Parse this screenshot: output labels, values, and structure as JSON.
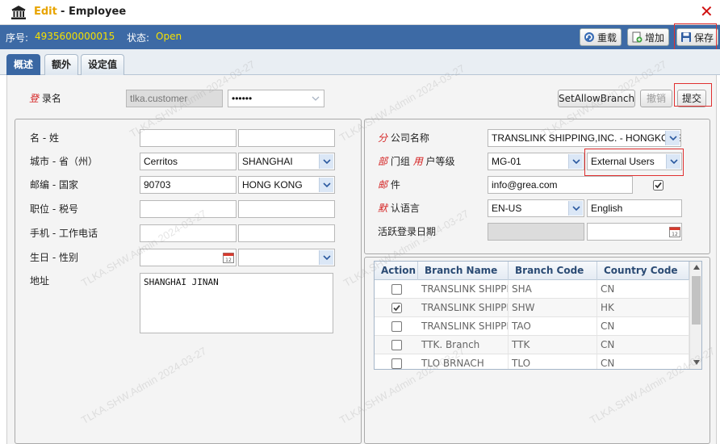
{
  "window": {
    "title_action": "Edit",
    "title_separator": "-",
    "title_entity": "Employee"
  },
  "infobar": {
    "serial_label": "序号:",
    "serial_value": "4935600000015",
    "status_label": "状态:",
    "status_value": "Open",
    "reload_label": "重载",
    "add_label": "增加",
    "save_label": "保存"
  },
  "tabs": [
    {
      "label": "概述"
    },
    {
      "label": "额外"
    },
    {
      "label": "设定值"
    }
  ],
  "login": {
    "label_req": "登",
    "label_rest": "录名",
    "username": "tlka.customer",
    "password": "••••••",
    "set_allow_branch_label": "SetAllowBranch",
    "cancel_label": "撤销",
    "submit_label": "提交"
  },
  "left_form": {
    "name_label": "名 - 姓",
    "first_name": "",
    "last_name": "",
    "city_label": "城市 - 省（州）",
    "city": "Cerritos",
    "province": "SHANGHAI",
    "postal_label": "邮编 - 国家",
    "postal": "90703",
    "country": "HONG KONG",
    "position_label": "职位 - 税号",
    "position": "",
    "tax_no": "",
    "mobile_label": "手机 - 工作电话",
    "mobile": "",
    "work_phone": "",
    "birthday_label": "生日 - 性别",
    "birthday": "",
    "gender": "",
    "address_label": "地址",
    "address": "SHANGHAI JINAN"
  },
  "right_form": {
    "company_req": "分",
    "company_rest": "公司名称",
    "company": "TRANSLINK SHIPPING,INC. - HONGKONG",
    "dept_req1": "部",
    "dept_mid": "门组",
    "dept_req2": "用",
    "dept_rest": "户等级",
    "group": "MG-01",
    "user_level": "External Users",
    "email_req": "邮",
    "email_rest": "件",
    "email": "info@grea.com",
    "email_checked": true,
    "lang_req": "默",
    "lang_rest": "认语言",
    "lang_code": "EN-US",
    "lang_name": "English",
    "active_label": "活跃登录日期",
    "active_date": "",
    "active_date2": ""
  },
  "branch_grid": {
    "headers": [
      "Action",
      "Branch Name",
      "Branch Code",
      "Country Code"
    ],
    "rows": [
      {
        "checked": false,
        "name": "TRANSLINK SHIPPING",
        "code": "SHA",
        "country": "CN"
      },
      {
        "checked": true,
        "name": "TRANSLINK SHIPPING",
        "code": "SHW",
        "country": "HK"
      },
      {
        "checked": false,
        "name": "TRANSLINK SHIPPING",
        "code": "TAO",
        "country": "CN"
      },
      {
        "checked": false,
        "name": "TTK. Branch",
        "code": "TTK",
        "country": "CN"
      },
      {
        "checked": false,
        "name": "TLO BRNACH",
        "code": "TLO",
        "country": "CN"
      }
    ]
  },
  "watermark": "TLKA.SHW.Admin 2024-03-27",
  "colors": {
    "header_blue": "#3d6aa5",
    "status_yellow": "#f6e000",
    "title_orange": "#e8a400",
    "required_red": "#d42020",
    "highlight_red": "#e03030"
  }
}
